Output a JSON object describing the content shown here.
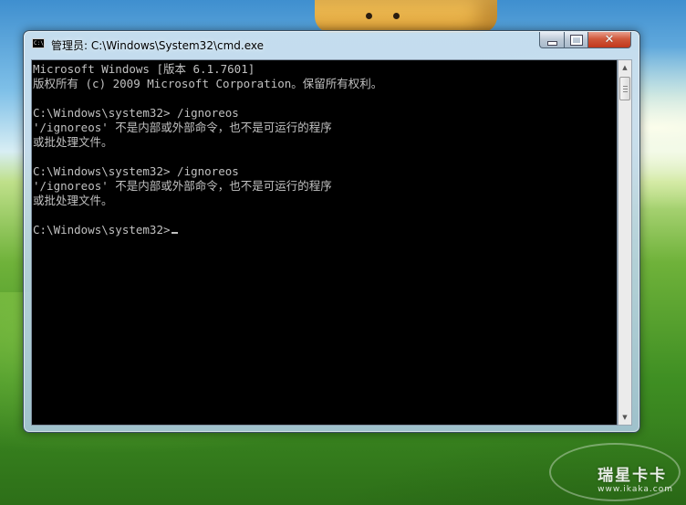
{
  "window": {
    "title": "管理员: C:\\Windows\\System32\\cmd.exe",
    "icon": "cmd-icon",
    "icon_text": "C:\\",
    "controls": {
      "minimize": "minimize-icon",
      "maximize": "maximize-icon",
      "close": "close-icon",
      "close_glyph": "✕"
    }
  },
  "console": {
    "lines": [
      "Microsoft Windows [版本 6.1.7601]",
      "版权所有 (c) 2009 Microsoft Corporation。保留所有权利。",
      "",
      "C:\\Windows\\system32> /ignoreos",
      "'/ignoreos' 不是内部或外部命令，也不是可运行的程序",
      "或批处理文件。",
      "",
      "C:\\Windows\\system32> /ignoreos",
      "'/ignoreos' 不是内部或外部命令，也不是可运行的程序",
      "或批处理文件。",
      "",
      "C:\\Windows\\system32>"
    ],
    "text_color": "#c0c0c0",
    "background": "#000000"
  },
  "scrollbar": {
    "up_glyph": "▲",
    "down_glyph": "▼"
  },
  "watermark": {
    "brand": "瑞星卡卡",
    "url": "www.ikaka.com"
  }
}
